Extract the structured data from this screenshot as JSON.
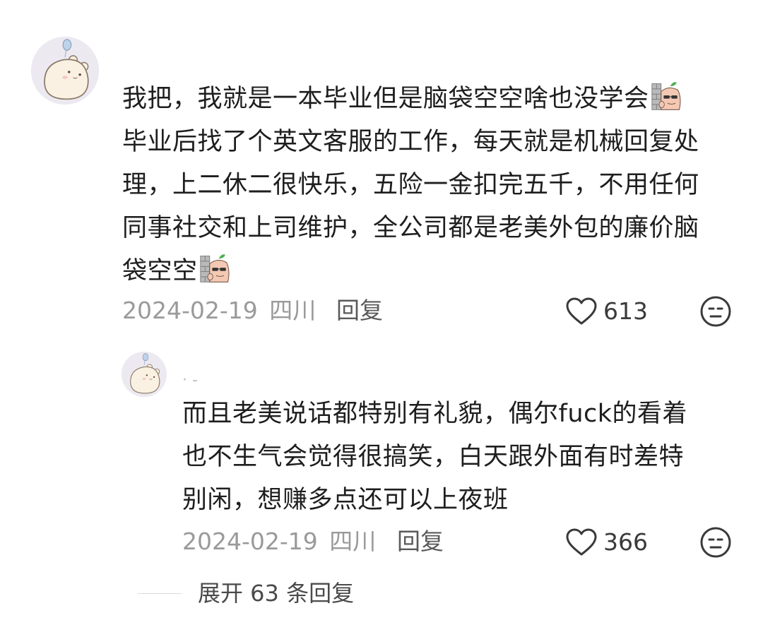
{
  "comment": {
    "username": "",
    "avatar_icon": "hamster-avatar-icon",
    "lines": [
      "我把，我就是一本毕业但是脑袋空空啥也没学会",
      "毕业后找了个英文客服的工作，每天就是机械回复处",
      "理，上二休二很快乐，五险一金扣完五千，不用任何",
      "同事社交和上司维护，全公司都是老美外包的廉价脑",
      "袋空空"
    ],
    "emoji_icon": "peeking-sunglasses-emoji-icon",
    "date": "2024-02-19",
    "location": "四川",
    "reply_label": "回复",
    "likes": "613"
  },
  "reply": {
    "username": "·  -",
    "avatar_icon": "hamster-avatar-icon",
    "lines": [
      "而且老美说话都特别有礼貌，偶尔fuck的看着",
      "也不生气会觉得很搞笑，白天跟外面有时差特",
      "别闲，想赚多点还可以上夜班"
    ],
    "date": "2024-02-19",
    "location": "四川",
    "reply_label": "回复",
    "likes": "366"
  },
  "expand": {
    "label": "展开 63 条回复"
  },
  "colors": {
    "text": "#1e1e1e",
    "meta": "#9a9a9a",
    "icon": "#555555",
    "avatar_bg": "#ece9f1"
  }
}
